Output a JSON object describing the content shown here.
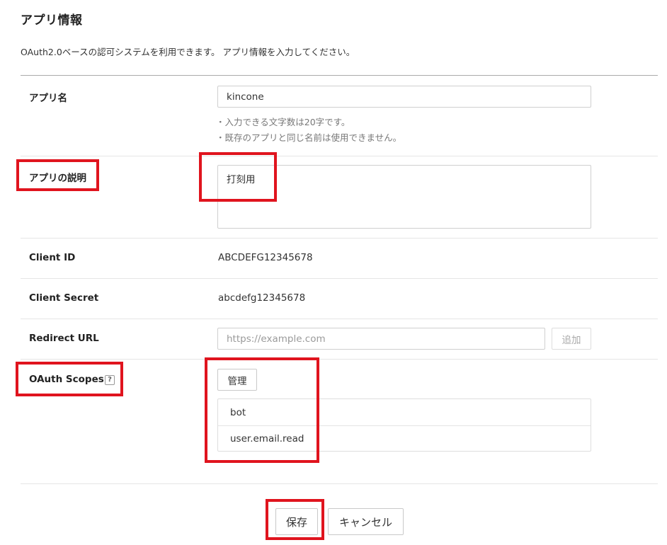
{
  "page": {
    "title": "アプリ情報",
    "subtitle": "OAuth2.0ベースの認可システムを利用できます。 アプリ情報を入力してください。"
  },
  "form": {
    "app_name": {
      "label": "アプリ名",
      "value": "kincone",
      "hints": [
        "・入力できる文字数は20字です。",
        "・既存のアプリと同じ名前は使用できません。"
      ]
    },
    "description": {
      "label": "アプリの説明",
      "value": "打刻用"
    },
    "client_id": {
      "label": "Client ID",
      "value": "ABCDEFG12345678"
    },
    "client_secret": {
      "label": "Client Secret",
      "value": "abcdefg12345678"
    },
    "redirect_url": {
      "label": "Redirect URL",
      "placeholder": "https://example.com",
      "add_label": "追加"
    },
    "oauth_scopes": {
      "label": "OAuth Scopes",
      "help_glyph": "?",
      "manage_label": "管理",
      "scopes": [
        "bot",
        "user.email.read"
      ]
    }
  },
  "actions": {
    "save_label": "保存",
    "cancel_label": "キャンセル"
  },
  "icons": {
    "help": "help-icon"
  },
  "colors": {
    "highlight": "#e0141e"
  }
}
